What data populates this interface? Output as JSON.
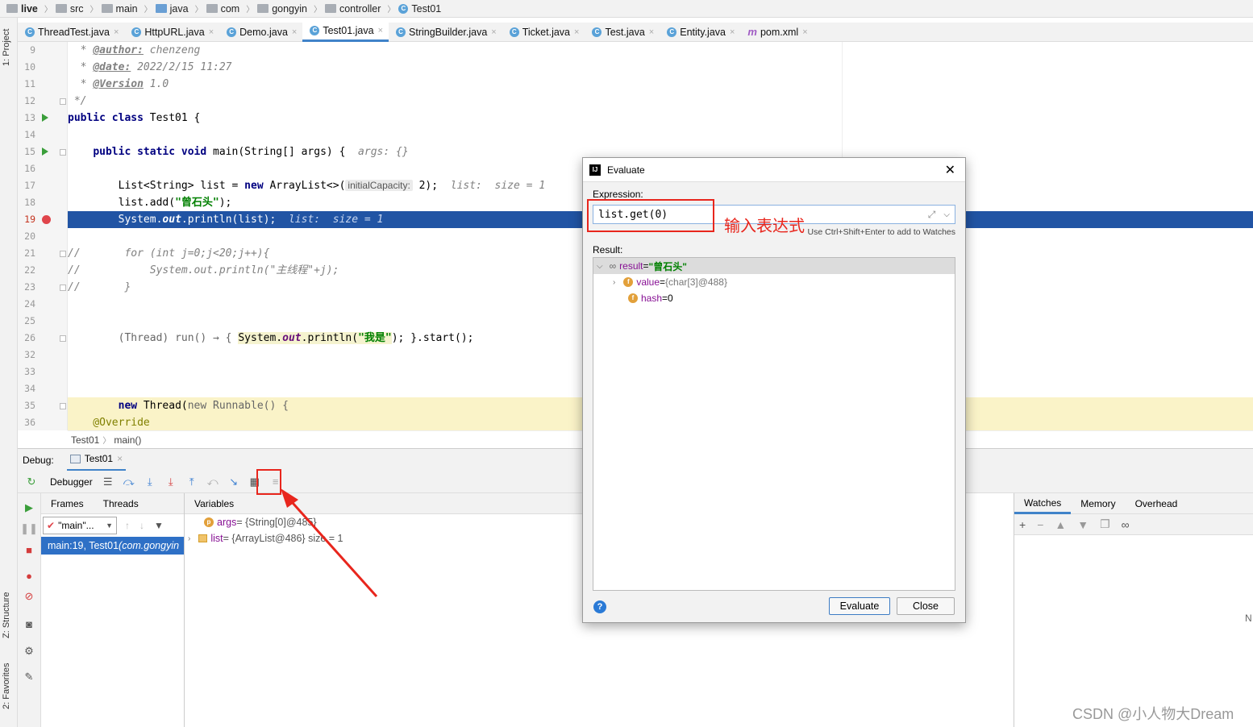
{
  "breadcrumb": {
    "items": [
      "live",
      "src",
      "main",
      "java",
      "com",
      "gongyin",
      "controller",
      "Test01"
    ]
  },
  "tabs": [
    {
      "label": "ThreadTest.java",
      "active": false
    },
    {
      "label": "HttpURL.java",
      "active": false
    },
    {
      "label": "Demo.java",
      "active": false
    },
    {
      "label": "Test01.java",
      "active": true
    },
    {
      "label": "StringBuilder.java",
      "active": false
    },
    {
      "label": "Ticket.java",
      "active": false
    },
    {
      "label": "Test.java",
      "active": false
    },
    {
      "label": "Entity.java",
      "active": false
    },
    {
      "label": "pom.xml",
      "active": false
    }
  ],
  "side_labels": {
    "project": "1: Project",
    "structure": "Z: Structure",
    "favorites": "2: Favorites"
  },
  "code": {
    "line_numbers": [
      "9",
      "10",
      "11",
      "12",
      "13",
      "14",
      "15",
      "16",
      "17",
      "18",
      "19",
      "20",
      "21",
      "22",
      "23",
      "24",
      "25",
      "26",
      "32",
      "33",
      "34",
      "35",
      "36"
    ],
    "author_tag": "@author:",
    "author_val": " chenzeng",
    "date_tag": "@date:",
    "date_val": " 2022/2/15 11:27",
    "version_tag": "@Version",
    "version_val": " 1.0",
    "comment_end": " */",
    "l13a": "public class",
    "l13b": " Test01 {",
    "l15a": "public static void",
    "l15b": " main(String[] args) {  ",
    "l15c": "args: {}",
    "l17a": "List<String> list = ",
    "l17b": "new",
    "l17c": " ArrayList<>(",
    "l17hint": "initialCapacity:",
    "l17d": " 2);  ",
    "l17e": "list:  size = 1",
    "l18a": "list.add(",
    "l18b": "\"曾石头\"",
    "l18c": ");",
    "l19a": "System.",
    "l19b": "out",
    "l19c": ".println(list);  ",
    "l19d": "list:  size = 1",
    "l21": "//       for (int j=0;j<20;j++){",
    "l22": "//           System.out.println(\"主线程\"+j);",
    "l23": "//       }",
    "l26a": "(Thread) run() → { ",
    "l26b": "System.",
    "l26c": "out",
    "l26d": ".println(",
    "l26e": "\"我是\"",
    "l26f": "); }.start();",
    "l35a": "new",
    "l35b": " Thread(",
    "l35c": "new Runnable() {",
    "l36": "    @Override"
  },
  "nav_crumbs": [
    "Test01",
    "main()"
  ],
  "debug": {
    "label": "Debug:",
    "session": "Test01",
    "toolbar_label": "Debugger",
    "frames_tab": "Frames",
    "threads_tab": "Threads",
    "thread_select": "\"main\"...",
    "frame_main": "main:19, Test01",
    "frame_pkg": " (com.gongyin",
    "vars_header": "Variables",
    "var1_name": "args",
    "var1_val": " = {String[0]@485}",
    "var2_name": "list",
    "var2_val": " = {ArrayList@486}  size = 1",
    "watches": "Watches",
    "memory": "Memory",
    "overhead": "Overhead"
  },
  "dialog": {
    "title": "Evaluate",
    "expression_label": "Expression:",
    "expression_value": "list.get(0)",
    "hint": "Use Ctrl+Shift+Enter to add to Watches",
    "result_label": "Result:",
    "result_name": "result",
    "result_val": "\"曾石头\"",
    "value_name": "value",
    "value_val": "{char[3]@488}",
    "hash_name": "hash",
    "hash_val": "0",
    "evaluate_btn": "Evaluate",
    "close_btn": "Close"
  },
  "annotation": {
    "text": "输入表达式",
    "color": "#e8261d"
  },
  "watermark": "CSDN @小人物大Dream",
  "edge_char": "N"
}
